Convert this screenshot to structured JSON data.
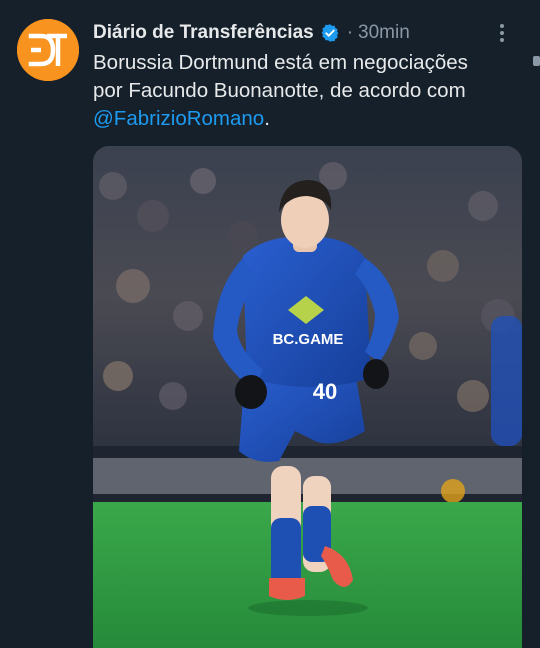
{
  "tweet": {
    "author_name": "Diário de Transferências",
    "avatar_logo": "DT",
    "separator": "·",
    "time": "30min",
    "text_line1": "Borussia Dortmund está em negociações",
    "text_line2_prefix": "por Facundo Buonanotte, de acordo com",
    "mention": "@FabrizioRomano",
    "text_suffix": ".",
    "shirt_number": "40",
    "shirt_sponsor": "BC.GAME"
  },
  "icons": {
    "verified": "verified-badge-icon",
    "more": "more-options-icon"
  },
  "colors": {
    "background": "#15202b",
    "text": "#e7e9ea",
    "secondary": "#8b98a5",
    "link": "#1d9bf0",
    "avatar": "#f7931e",
    "kit": "#1d4fb8",
    "pitch": "#2fa043"
  }
}
